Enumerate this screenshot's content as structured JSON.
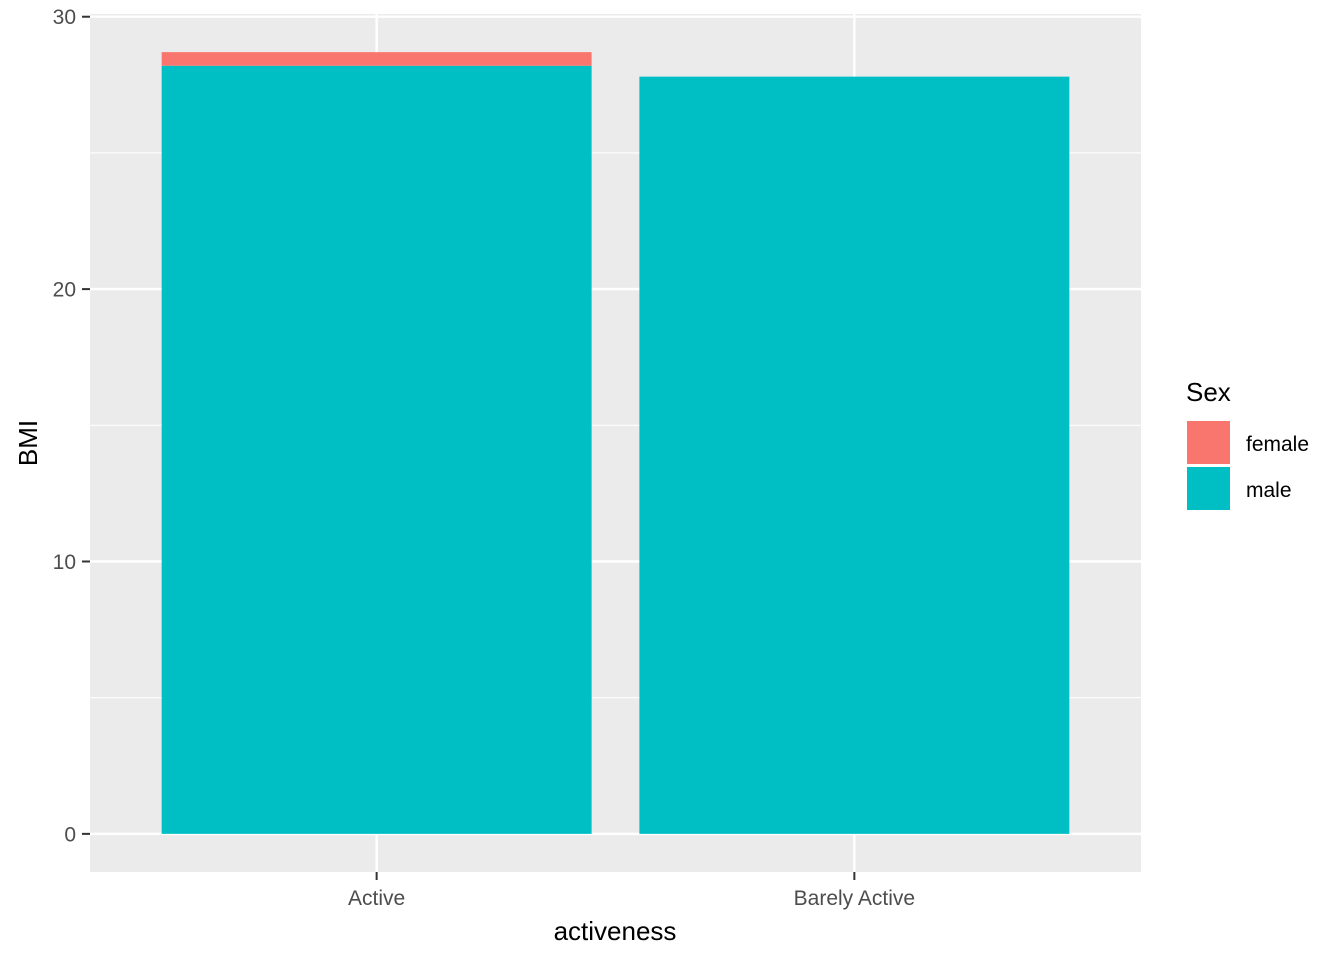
{
  "chart_data": {
    "type": "bar",
    "stacked": true,
    "categories": [
      "Active",
      "Barely Active"
    ],
    "series": [
      {
        "name": "female",
        "values": [
          0.5,
          0
        ],
        "color": "#F8766D"
      },
      {
        "name": "male",
        "values": [
          28.2,
          27.8
        ],
        "color": "#00BFC4"
      }
    ],
    "title": "",
    "xlabel": "activeness",
    "ylabel": "BMI",
    "ylim": [
      -1.4,
      30.1
    ],
    "yticks": [
      0,
      10,
      20,
      30
    ],
    "ytick_labels": [
      "0",
      "10",
      "20",
      "30"
    ],
    "grid": true,
    "legend": {
      "title": "Sex",
      "position": "right"
    },
    "panel_background": "#EBEBEB",
    "grid_color": "#FFFFFF"
  }
}
